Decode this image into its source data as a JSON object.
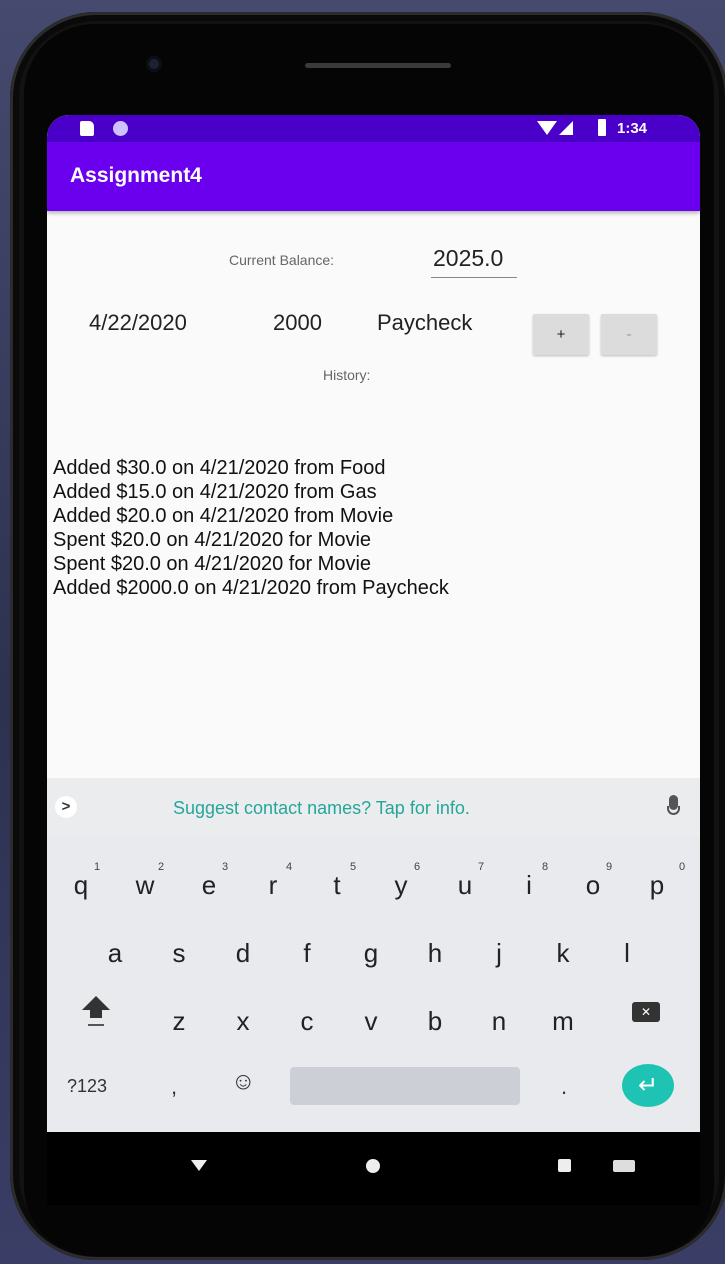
{
  "status_bar": {
    "time": "1:34"
  },
  "app": {
    "title": "Assignment4"
  },
  "balance": {
    "label": "Current Balance:",
    "value": "2025.0"
  },
  "entry": {
    "date": "4/22/2020",
    "amount": "2000",
    "description": "Paycheck",
    "add_label": "+",
    "subtract_label": "-"
  },
  "history": {
    "label": "History:",
    "items": [
      "Added $30.0 on 4/21/2020 from Food",
      "Added $15.0 on 4/21/2020 from Gas",
      "Added $20.0 on 4/21/2020 from Movie",
      "Spent $20.0 on 4/21/2020 for Movie",
      "Spent $20.0 on 4/21/2020 for Movie",
      "Added $2000.0 on 4/21/2020 from Paycheck"
    ]
  },
  "keyboard": {
    "suggestion": "Suggest contact names? Tap for info.",
    "row1": [
      "q",
      "w",
      "e",
      "r",
      "t",
      "y",
      "u",
      "i",
      "o",
      "p"
    ],
    "row1_numbers": [
      "1",
      "2",
      "3",
      "4",
      "5",
      "6",
      "7",
      "8",
      "9",
      "0"
    ],
    "row2": [
      "a",
      "s",
      "d",
      "f",
      "g",
      "h",
      "j",
      "k",
      "l"
    ],
    "row3": [
      "z",
      "x",
      "c",
      "v",
      "b",
      "n",
      "m"
    ],
    "symbols_label": "?123",
    "comma": ",",
    "period": ".",
    "emoji": "☺",
    "enter": "↵",
    "backspace": "✕",
    "suggest_arrow": ">"
  },
  "colors": {
    "status_bar": "#4a00c8",
    "app_bar": "#6a00ee",
    "accent": "#1fc3b3",
    "suggestion_text": "#26a69a"
  }
}
